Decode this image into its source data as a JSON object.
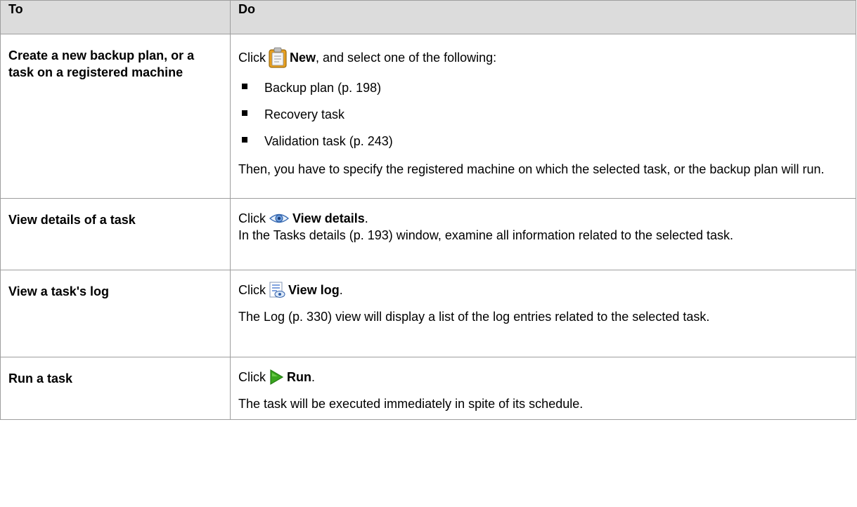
{
  "header": {
    "col1": "To",
    "col2": "Do"
  },
  "rows": [
    {
      "task": "Create a new backup plan, or a task on a registered machine",
      "click_prefix": "Click",
      "action": "New",
      "action_suffix": ", and select one of the following:",
      "options": [
        "Backup plan (p. 198)",
        "Recovery task",
        "Validation task (p. 243)"
      ],
      "note": "Then, you have to specify the registered machine on which the selected task, or the backup plan will run.",
      "icon": "new-clipboard-icon"
    },
    {
      "task": "View details of a task",
      "click_prefix": "Click",
      "action": "View details",
      "action_suffix": ".",
      "note": "In the Tasks details (p. 193) window, examine all information related to the selected task.",
      "icon": "eye-icon"
    },
    {
      "task": "View a task's log",
      "click_prefix": "Click",
      "action": "View log",
      "action_suffix": ".",
      "note": "The Log (p. 330) view will display a list of the log entries related to the selected task.",
      "icon": "view-log-icon"
    },
    {
      "task": "Run a task",
      "click_prefix": "Click",
      "action": "Run",
      "action_suffix": ".",
      "note": "The task will be executed immediately in spite of its schedule.",
      "icon": "run-arrow-icon"
    }
  ],
  "colors": {
    "header_bg": "#dcdcdc",
    "border": "#9e9e9e",
    "run_green": "#3aa61f",
    "new_orange": "#e8a020"
  }
}
